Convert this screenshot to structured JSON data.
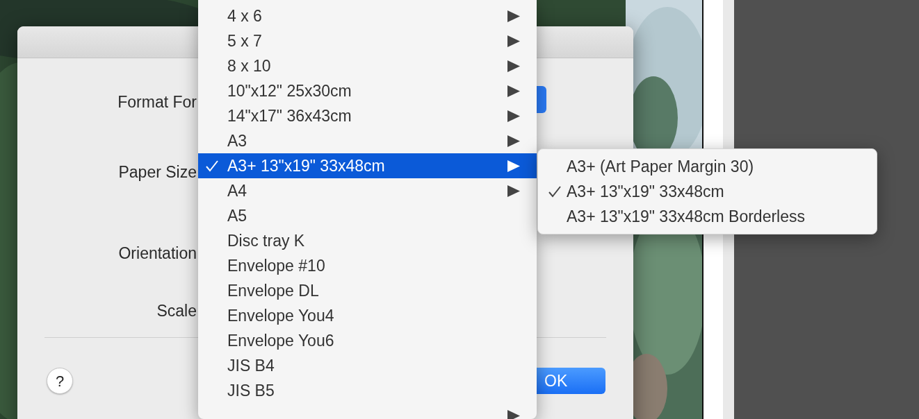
{
  "dialog": {
    "fields": [
      {
        "label": "Format For"
      },
      {
        "label": "Paper Size"
      },
      {
        "label": "Orientation"
      },
      {
        "label": "Scale"
      }
    ],
    "help_button": "?",
    "ok_button": "OK"
  },
  "menu": {
    "items": [
      {
        "label": "4 x 6",
        "submenu": true,
        "selected": false,
        "checked": false
      },
      {
        "label": "5 x 7",
        "submenu": true,
        "selected": false,
        "checked": false
      },
      {
        "label": "8 x 10",
        "submenu": true,
        "selected": false,
        "checked": false
      },
      {
        "label": "10\"x12\" 25x30cm",
        "submenu": true,
        "selected": false,
        "checked": false
      },
      {
        "label": "14\"x17\" 36x43cm",
        "submenu": true,
        "selected": false,
        "checked": false
      },
      {
        "label": "A3",
        "submenu": true,
        "selected": false,
        "checked": false
      },
      {
        "label": "A3+ 13\"x19\" 33x48cm",
        "submenu": true,
        "selected": true,
        "checked": true
      },
      {
        "label": "A4",
        "submenu": true,
        "selected": false,
        "checked": false
      },
      {
        "label": "A5",
        "submenu": false,
        "selected": false,
        "checked": false
      },
      {
        "label": "Disc tray K",
        "submenu": false,
        "selected": false,
        "checked": false
      },
      {
        "label": "Envelope #10",
        "submenu": false,
        "selected": false,
        "checked": false
      },
      {
        "label": "Envelope DL",
        "submenu": false,
        "selected": false,
        "checked": false
      },
      {
        "label": "Envelope You4",
        "submenu": false,
        "selected": false,
        "checked": false
      },
      {
        "label": "Envelope You6",
        "submenu": false,
        "selected": false,
        "checked": false
      },
      {
        "label": "JIS B4",
        "submenu": false,
        "selected": false,
        "checked": false
      },
      {
        "label": "JIS B5",
        "submenu": false,
        "selected": false,
        "checked": false
      },
      {
        "submenu": true,
        "selected": false,
        "checked": false
      }
    ]
  },
  "submenu": {
    "items": [
      {
        "label": "A3+ (Art Paper Margin 30)",
        "checked": false
      },
      {
        "label": "A3+ 13\"x19\" 33x48cm",
        "checked": true
      },
      {
        "label": "A3+ 13\"x19\" 33x48cm Borderless",
        "checked": false
      }
    ]
  }
}
